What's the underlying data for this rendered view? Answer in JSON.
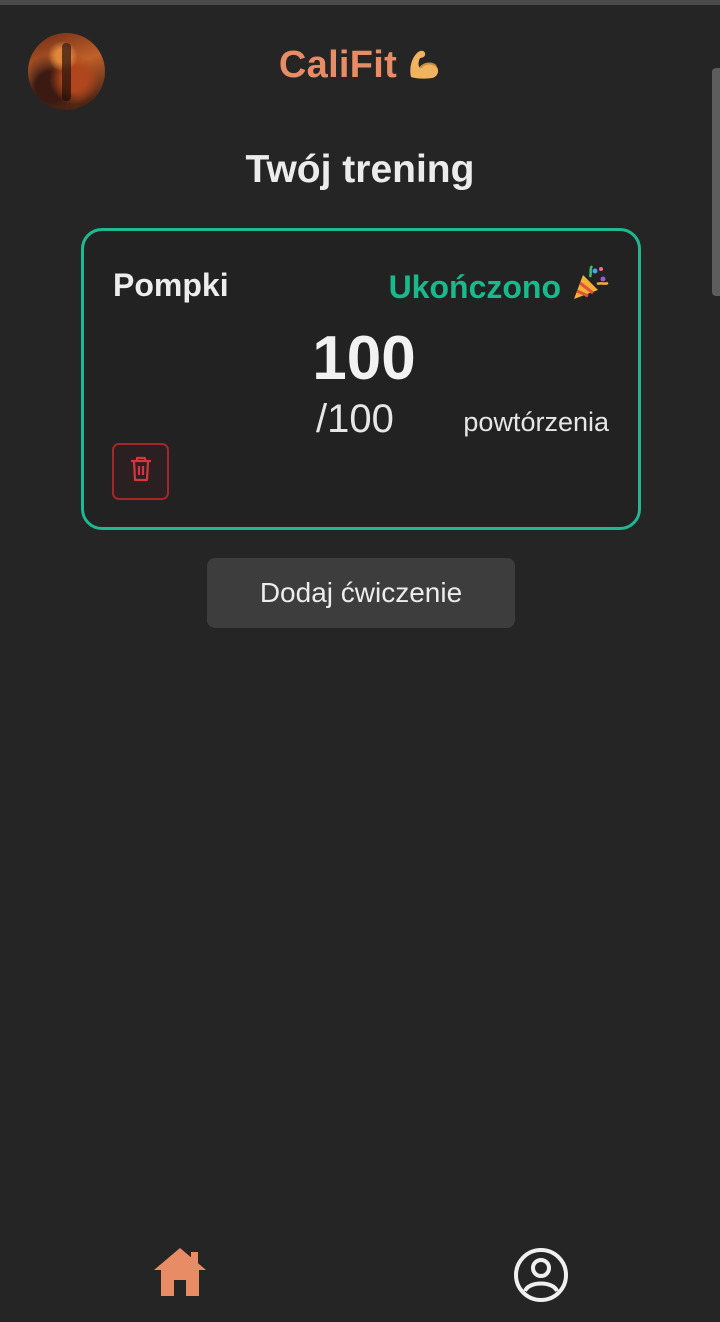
{
  "app": {
    "brand_name": "CaliFit",
    "brand_icon": "flexed-biceps-icon",
    "accent_color": "#e88c65"
  },
  "header": {
    "avatar": "user-avatar"
  },
  "page": {
    "title": "Twój trening"
  },
  "exercises": [
    {
      "name": "Pompki",
      "status": "Ukończono",
      "status_icon": "party-popper-icon",
      "status_color": "#19b98c",
      "reps_done": "100",
      "reps_target": "/100",
      "unit": "powtórzenia",
      "delete_icon": "trash-icon"
    }
  ],
  "actions": {
    "add_exercise_label": "Dodaj ćwiczenie"
  },
  "bottom_nav": {
    "items": [
      {
        "icon": "home-icon",
        "active": true
      },
      {
        "icon": "profile-icon",
        "active": false
      }
    ]
  }
}
